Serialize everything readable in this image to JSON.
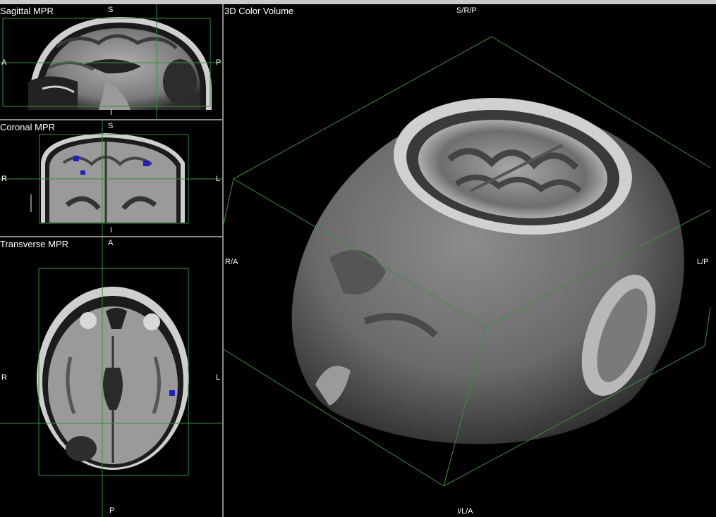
{
  "window": {
    "frame_color": "#c9c9c9",
    "crosshair_color": "#3a8f3a",
    "selection_color": "#2020c0"
  },
  "views": {
    "sagittal": {
      "title": "Sagittal MPR",
      "orient": {
        "top": "S",
        "bottom": "I",
        "left": "A",
        "right": "P"
      }
    },
    "coronal": {
      "title": "Coronal MPR",
      "orient": {
        "top": "S",
        "bottom": "I",
        "left": "R",
        "right": "L"
      }
    },
    "transverse": {
      "title": "Transverse MPR",
      "orient": {
        "top": "A",
        "bottom": "P",
        "left": "R",
        "right": "L"
      }
    },
    "volume": {
      "title": "3D Color Volume",
      "orient": {
        "top": "S/R/P",
        "bottom": "I/L/A",
        "left": "R/A",
        "right": "L/P"
      }
    }
  }
}
